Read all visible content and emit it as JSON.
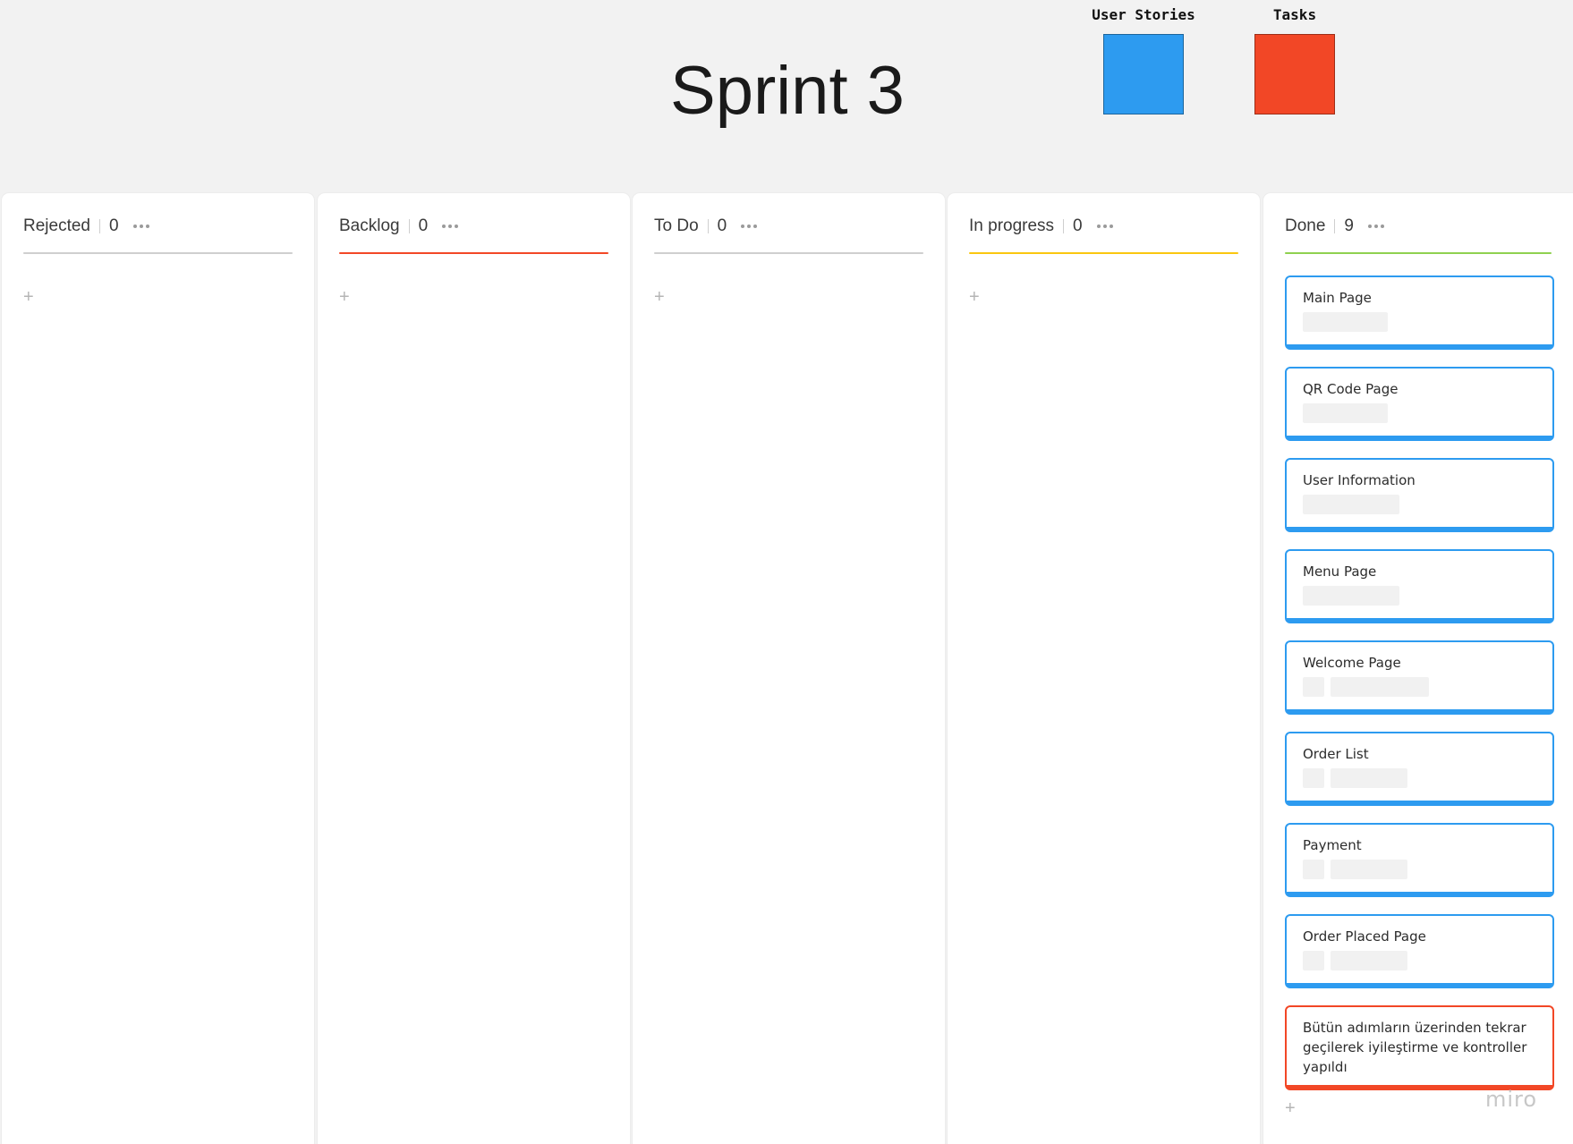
{
  "title": "Sprint 3",
  "legend": {
    "stories": {
      "label": "User Stories",
      "color": "#2d9bf0"
    },
    "tasks": {
      "label": "Tasks",
      "color": "#f24726"
    }
  },
  "columns": [
    {
      "name": "Rejected",
      "count": "0",
      "line_color": "#cfcfcf",
      "add": "+"
    },
    {
      "name": "Backlog",
      "count": "0",
      "line_color": "#f24726",
      "add": "+"
    },
    {
      "name": "To Do",
      "count": "0",
      "line_color": "#cfcfcf",
      "add": "+"
    },
    {
      "name": "In progress",
      "count": "0",
      "line_color": "#fac710",
      "add": "+"
    },
    {
      "name": "Done",
      "count": "9",
      "line_color": "#8fd14f",
      "add": "+"
    }
  ],
  "done_cards": [
    {
      "title": "Main Page",
      "type": "story"
    },
    {
      "title": "QR Code Page",
      "type": "story"
    },
    {
      "title": "User Information",
      "type": "story"
    },
    {
      "title": "Menu Page",
      "type": "story"
    },
    {
      "title": "Welcome Page",
      "type": "story"
    },
    {
      "title": "Order List",
      "type": "story"
    },
    {
      "title": "Payment",
      "type": "story"
    },
    {
      "title": "Order Placed Page",
      "type": "story"
    },
    {
      "title": "Bütün adımların üzerinden tekrar geçilerek iyileştirme ve kontroller yapıldı",
      "type": "task"
    }
  ],
  "watermark": "miro"
}
